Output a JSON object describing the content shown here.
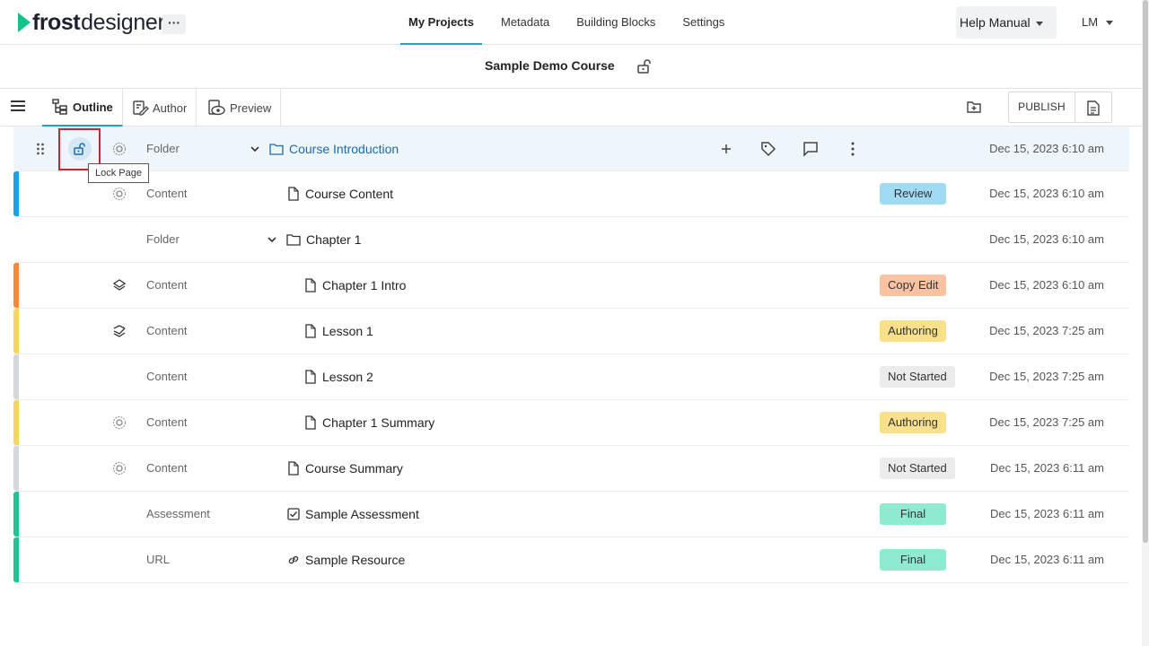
{
  "app": {
    "brand_bold": "frost",
    "brand_light": "designer",
    "more_label": "···"
  },
  "nav": {
    "items": [
      {
        "label": "My Projects",
        "active": true
      },
      {
        "label": "Metadata"
      },
      {
        "label": "Building Blocks"
      },
      {
        "label": "Settings"
      }
    ],
    "help_label": "Help Manual",
    "user_label": "LM"
  },
  "course": {
    "title": "Sample Demo Course"
  },
  "toolbar": {
    "tabs": [
      {
        "label": "Outline",
        "active": true
      },
      {
        "label": "Author"
      },
      {
        "label": "Preview"
      }
    ],
    "publish_label": "PUBLISH"
  },
  "tooltip": {
    "text": "Lock Page"
  },
  "outline": {
    "rows": [
      {
        "type": "Folder",
        "name": "Course Introduction",
        "status": "",
        "date": "Dec 15, 2023 6:10 am"
      },
      {
        "type": "Content",
        "name": "Course Content",
        "status": "Review",
        "date": "Dec 15, 2023 6:10 am",
        "bar_color": "#1aa3dc"
      },
      {
        "type": "Folder",
        "name": "Chapter 1",
        "status": "",
        "date": "Dec 15, 2023 6:10 am"
      },
      {
        "type": "Content",
        "name": "Chapter 1 Intro",
        "status": "Copy Edit",
        "date": "Dec 15, 2023 6:10 am",
        "bar_color": "#f5873b"
      },
      {
        "type": "Content",
        "name": "Lesson 1",
        "status": "Authoring",
        "date": "Dec 15, 2023 7:25 am",
        "bar_color": "#f8d55b"
      },
      {
        "type": "Content",
        "name": "Lesson 2",
        "status": "Not Started",
        "date": "Dec 15, 2023 7:25 am",
        "bar_color": "#d5d8da"
      },
      {
        "type": "Content",
        "name": "Chapter 1 Summary",
        "status": "Authoring",
        "date": "Dec 15, 2023 7:25 am",
        "bar_color": "#f8d55b"
      },
      {
        "type": "Content",
        "name": "Course Summary",
        "status": "Not Started",
        "date": "Dec 15, 2023 6:11 am",
        "bar_color": "#d5d8da"
      },
      {
        "type": "Assessment",
        "name": "Sample Assessment",
        "status": "Final",
        "date": "Dec 15, 2023 6:11 am",
        "bar_color": "#1ec495"
      },
      {
        "type": "URL",
        "name": "Sample Resource",
        "status": "Final",
        "date": "Dec 15, 2023 6:11 am",
        "bar_color": "#1ec495"
      }
    ]
  }
}
